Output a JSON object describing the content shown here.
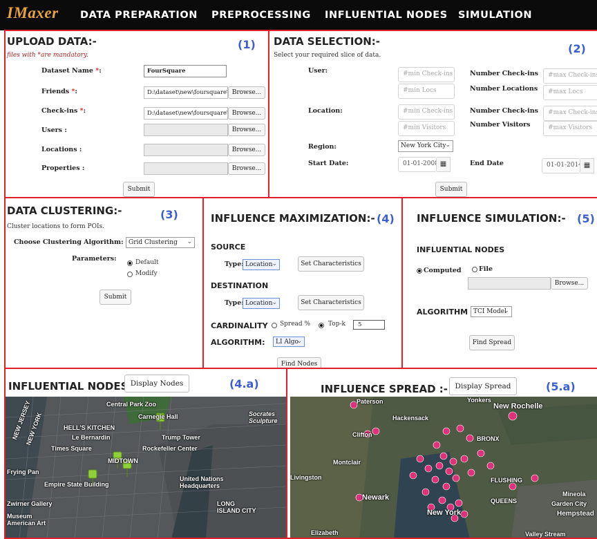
{
  "nav": {
    "brand": "IMaxer",
    "items": [
      "DATA PREPARATION",
      "PREPROCESSING",
      "INFLUENTIAL NODES",
      "SIMULATION"
    ]
  },
  "upload": {
    "title": "UPLOAD DATA:-",
    "num": "(1)",
    "note": "files with *are mandatory.",
    "dataset_label": "Dataset Name",
    "dataset_value": "FourSquare",
    "friends_label": "Friends",
    "friends_value": "D:\\dataset\\new\\foursquare\\",
    "checkins_label": "Check-ins",
    "checkins_value": "D:\\dataset\\new\\foursquare\\",
    "users_label": "Users :",
    "locations_label": "Locations :",
    "properties_label": "Properties :",
    "star": "*",
    "colon": ":",
    "browse": "Browse...",
    "submit": "Submit"
  },
  "selection": {
    "title": "DATA SELECTION:-",
    "num": "(2)",
    "desc": "Select your required slice of data.",
    "user_label": "User:",
    "location_label": "Location:",
    "region_label": "Region:",
    "start_label": "Start Date:",
    "end_label": "End Date",
    "min_checkins": "#min Check-ins",
    "min_locs": "#min Locs",
    "min_visitors": "#min Visitors",
    "max_checkins": "#max Check-ins",
    "max_locs": "#max Locs",
    "max_visitors": "#max Visitors",
    "num_checkins": "Number Check-ins",
    "num_locations": "Number Locations",
    "num_visitors": "Number Visitors",
    "region_value": "New York City",
    "start_value": "01-01-2008",
    "end_value": "01-01-2014",
    "submit": "Submit"
  },
  "clustering": {
    "title": "DATA CLUSTERING:-",
    "num": "(3)",
    "desc": "Cluster locations to form POIs.",
    "choose_label": "Choose Clustering Algorithm:",
    "algo_value": "Grid Clustering",
    "params_label": "Parameters:",
    "opt_default": "Default",
    "opt_modify": "Modify",
    "submit": "Submit"
  },
  "maximization": {
    "title": "INFLUENCE MAXIMIZATION:-",
    "num": "(4)",
    "source": "SOURCE",
    "destination": "DESTINATION",
    "type_label": "Type:",
    "type_value": "Location",
    "set_char": "Set Characteristics",
    "cardinality": "CARDINALITY",
    "spread": "Spread %",
    "topk": "Top-k",
    "k_value": "5",
    "algorithm": "ALGORITHM:",
    "algo_value": "LI Algo",
    "find": "Find Nodes"
  },
  "simulation": {
    "title": "INFLUENCE SIMULATION:-",
    "num": "(5)",
    "nodes_heading": "INFLUENTIAL NODES",
    "computed": "Computed",
    "file": "File",
    "browse": "Browse...",
    "algorithm": "ALGORITHM",
    "algo_value": "TCI Model",
    "find": "Find Spread"
  },
  "nodes_map": {
    "title": "INFLUENTIAL NODES",
    "button": "Display Nodes",
    "num": "(4.a)",
    "labels": [
      "Central Park Zoo",
      "Carnegie Hall",
      "HELL'S KITCHEN",
      "Le Bernardin",
      "Trump Tower",
      "Times Square",
      "Rockefeller Center",
      "MIDTOWN",
      "Frying Pan",
      "NEW JERSEY",
      "NEW YORK",
      "Empire State Building",
      "United Nations Headquarters",
      "LONG ISLAND CITY",
      "Zwirner Gallery",
      "Museum American Art",
      "Socrates Sculpture"
    ]
  },
  "spread_map": {
    "title": "INFLUENCE SPREAD :-",
    "button": "Display Spread",
    "num": "(5.a)",
    "labels": [
      "Yonkers",
      "New Rochelle",
      "Paterson",
      "Hackensack",
      "Clifton",
      "Montclair",
      "Livingston",
      "Newark",
      "BRONX",
      "FLUSHING",
      "QUEENS",
      "Mineola",
      "Garden City",
      "Hempstead",
      "Elizabeth",
      "Valley Stream",
      "New York"
    ]
  },
  "colors": {
    "accent": "#e6a23c",
    "panel_border": "#e0202a",
    "number": "#3b5fcf",
    "marker": "#e0307a"
  }
}
